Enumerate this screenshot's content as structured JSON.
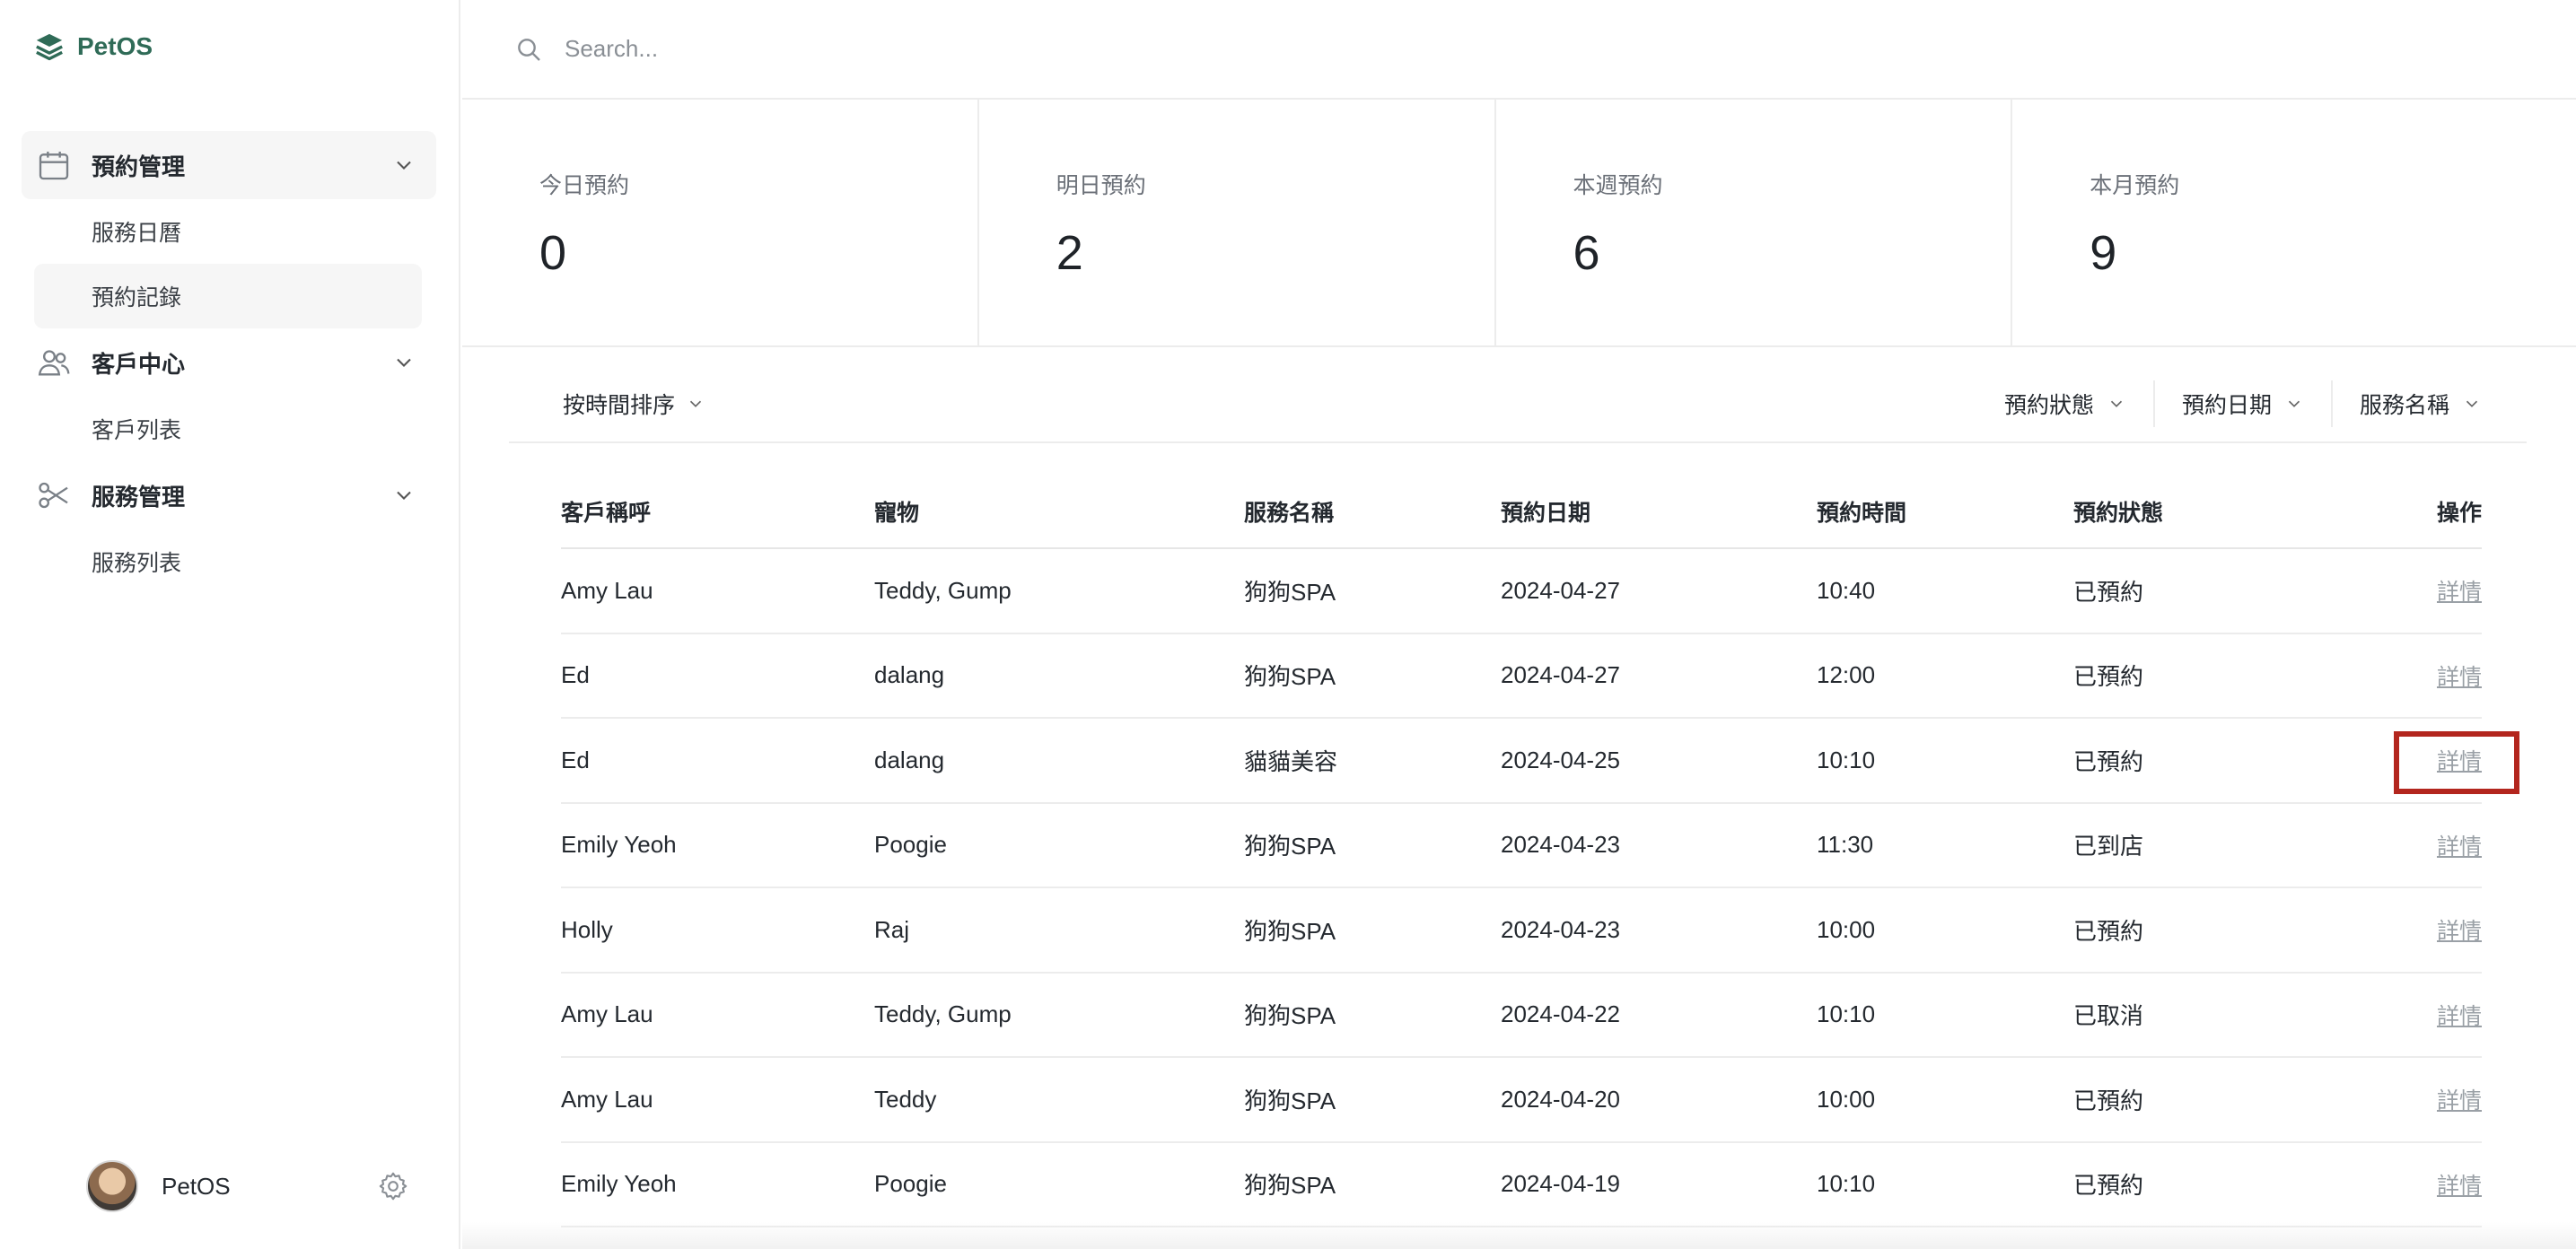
{
  "app": {
    "name": "PetOS"
  },
  "sidebar": {
    "groups": [
      {
        "label": "預約管理",
        "icon": "calendar-icon",
        "items": [
          "服務日曆",
          "預約記錄"
        ]
      },
      {
        "label": "客戶中心",
        "icon": "users-icon",
        "items": [
          "客戶列表"
        ]
      },
      {
        "label": "服務管理",
        "icon": "scissors-icon",
        "items": [
          "服務列表"
        ]
      }
    ],
    "selected_item": "預約記錄",
    "footer": {
      "name": "PetOS"
    }
  },
  "search": {
    "placeholder": "Search...",
    "value": ""
  },
  "stats": [
    {
      "label": "今日預約",
      "value": "0"
    },
    {
      "label": "明日預約",
      "value": "2"
    },
    {
      "label": "本週預約",
      "value": "6"
    },
    {
      "label": "本月預約",
      "value": "9"
    }
  ],
  "filters": {
    "sort_label": "按時間排序",
    "status_label": "預約狀態",
    "date_label": "預約日期",
    "service_label": "服務名稱"
  },
  "table": {
    "columns": [
      "客戶稱呼",
      "寵物",
      "服務名稱",
      "預約日期",
      "預約時間",
      "預約狀態",
      "操作"
    ],
    "action_label": "詳情",
    "rows": [
      [
        "Amy Lau",
        "Teddy, Gump",
        "狗狗SPA",
        "2024-04-27",
        "10:40",
        "已預約"
      ],
      [
        "Ed",
        "dalang",
        "狗狗SPA",
        "2024-04-27",
        "12:00",
        "已預約"
      ],
      [
        "Ed",
        "dalang",
        "貓貓美容",
        "2024-04-25",
        "10:10",
        "已預約"
      ],
      [
        "Emily Yeoh",
        "Poogie",
        "狗狗SPA",
        "2024-04-23",
        "11:30",
        "已到店"
      ],
      [
        "Holly",
        "Raj",
        "狗狗SPA",
        "2024-04-23",
        "10:00",
        "已預約"
      ],
      [
        "Amy Lau",
        "Teddy, Gump",
        "狗狗SPA",
        "2024-04-22",
        "10:10",
        "已取消"
      ],
      [
        "Amy Lau",
        "Teddy",
        "狗狗SPA",
        "2024-04-20",
        "10:00",
        "已預約"
      ],
      [
        "Emily Yeoh",
        "Poogie",
        "狗狗SPA",
        "2024-04-19",
        "10:10",
        "已預約"
      ]
    ]
  },
  "colors": {
    "brand": "#2f6b57",
    "highlight": "#b3261e",
    "link": "#9aa0a6"
  }
}
